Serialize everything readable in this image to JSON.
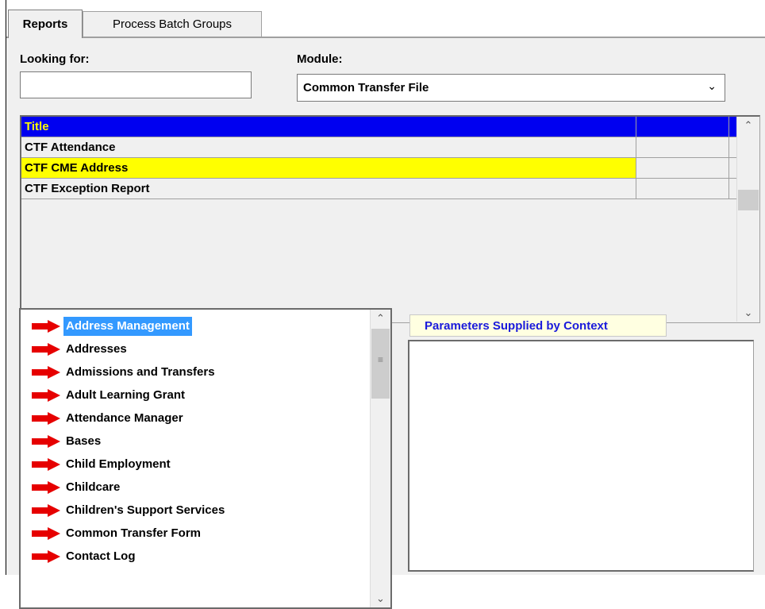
{
  "tabs": [
    {
      "label": "Reports",
      "active": true
    },
    {
      "label": "Process Batch Groups",
      "active": false
    }
  ],
  "search": {
    "label": "Looking for:",
    "value": ""
  },
  "module": {
    "label": "Module:",
    "selected": "Common Transfer File"
  },
  "grid": {
    "header": "Title",
    "rows": [
      {
        "title": "CTF Attendance",
        "selected": false
      },
      {
        "title": "CTF CME Address",
        "selected": true
      },
      {
        "title": "CTF Exception Report",
        "selected": false
      }
    ]
  },
  "categories": {
    "selected_index": 0,
    "items": [
      "Address Management",
      "Addresses",
      "Admissions and Transfers",
      "Adult Learning Grant",
      "Attendance Manager",
      "Bases",
      "Child Employment",
      "Childcare",
      "Children's Support Services",
      "Common Transfer Form",
      "Contact Log"
    ],
    "icon": "red-arrow-icon"
  },
  "parameters": {
    "header": "Parameters Supplied by Context"
  },
  "colors": {
    "header_bg": "#0000f0",
    "header_text": "#ffff00",
    "row_highlight": "#ffff00",
    "list_selection": "#3399ff",
    "arrow": "#e60000",
    "params_text": "#1a1adb"
  }
}
